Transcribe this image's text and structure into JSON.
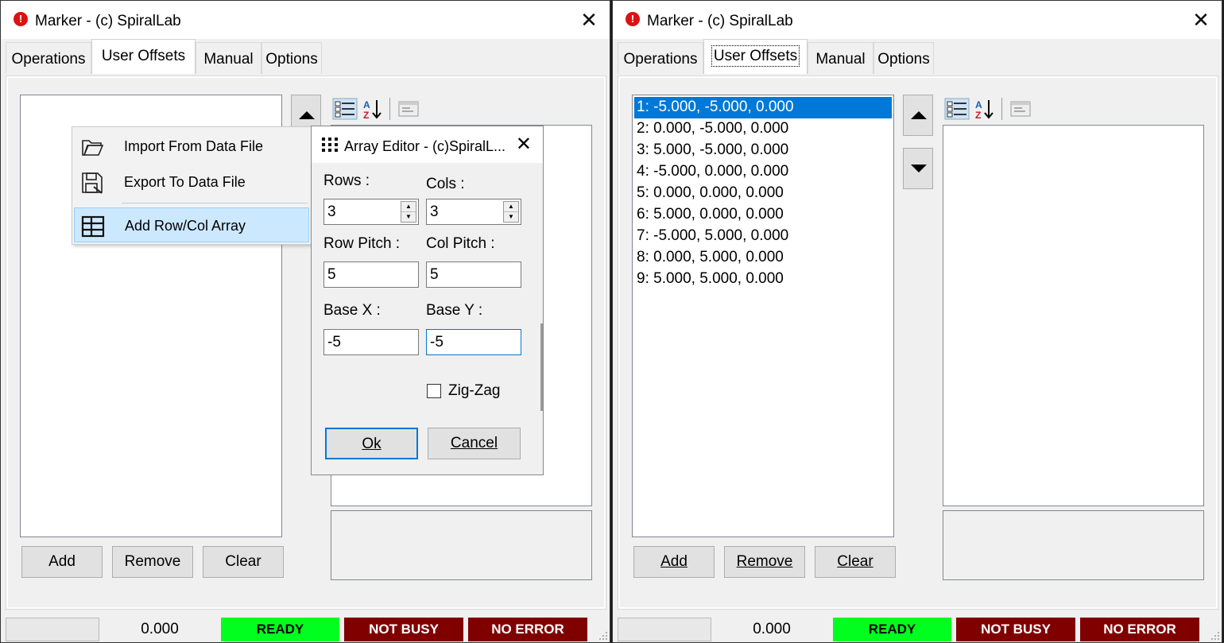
{
  "left_window": {
    "title": "Marker - (c) SpiralLab",
    "tabs": [
      "Operations",
      "User Offsets",
      "Manual",
      "Options"
    ],
    "active_tab": "User Offsets",
    "buttons": {
      "add": "Add",
      "remove": "Remove",
      "clear": "Clear"
    },
    "context_menu": {
      "items": [
        "Import From Data File",
        "Export To Data File",
        "Add Row/Col Array"
      ],
      "highlighted": "Add Row/Col Array"
    },
    "array_editor": {
      "title": "Array Editor - (c)SpiralL...",
      "rows_label": "Rows :",
      "cols_label": "Cols :",
      "rows_value": "3",
      "cols_value": "3",
      "row_pitch_label": "Row Pitch :",
      "col_pitch_label": "Col Pitch :",
      "row_pitch_value": "5",
      "col_pitch_value": "5",
      "base_x_label": "Base X :",
      "base_y_label": "Base Y :",
      "base_x_value": "-5",
      "base_y_value": "-5",
      "zigzag_label": "Zig-Zag",
      "zigzag_checked": false,
      "ok_label": "Ok",
      "cancel_label": "Cancel"
    },
    "status": {
      "value": "0.000",
      "ready": "READY",
      "busy": "NOT BUSY",
      "error": "NO ERROR"
    }
  },
  "right_window": {
    "title": "Marker - (c) SpiralLab",
    "tabs": [
      "Operations",
      "User Offsets",
      "Manual",
      "Options"
    ],
    "active_tab": "User Offsets",
    "offsets": [
      "1: -5.000, -5.000, 0.000",
      "2: 0.000, -5.000, 0.000",
      "3: 5.000, -5.000, 0.000",
      "4: -5.000, 0.000, 0.000",
      "5: 0.000, 0.000, 0.000",
      "6: 5.000, 0.000, 0.000",
      "7: -5.000, 5.000, 0.000",
      "8: 0.000, 5.000, 0.000",
      "9: 5.000, 5.000, 0.000"
    ],
    "selected_index": 0,
    "buttons": {
      "add": "Add",
      "remove": "Remove",
      "clear": "Clear"
    },
    "status": {
      "value": "0.000",
      "ready": "READY",
      "busy": "NOT BUSY",
      "error": "NO ERROR"
    }
  },
  "colors": {
    "ready": "#00ff1e",
    "status_red": "#800000",
    "selection": "#0078d7",
    "menu_highlight": "#cce8ff"
  },
  "icons": [
    "error-icon",
    "close-icon",
    "categorized-icon",
    "sort-az-icon",
    "property-pages-icon",
    "folder-open-icon",
    "save-icon",
    "table-grid-icon",
    "grip-dots-icon",
    "up-arrow-icon",
    "down-arrow-icon"
  ]
}
